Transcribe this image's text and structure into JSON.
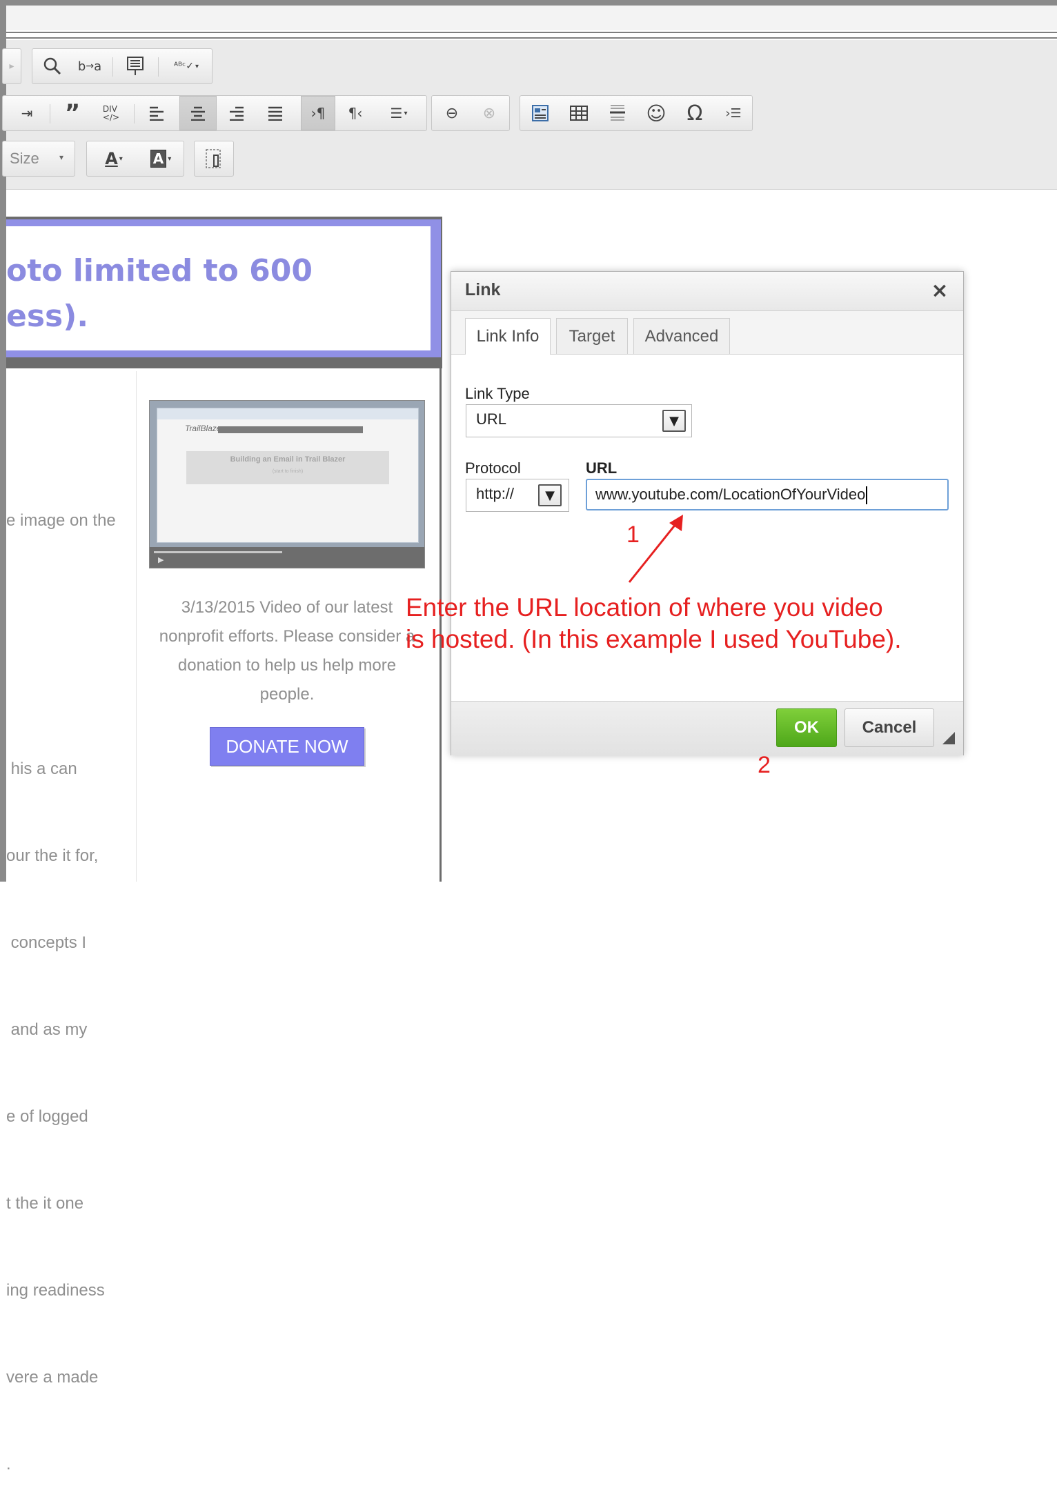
{
  "toolbar": {
    "row2_icons": [
      "indent-icon",
      "blockquote-icon",
      "create-div-icon",
      "align-left-icon",
      "align-center-icon",
      "align-right-icon",
      "justify-icon",
      "ltr-icon",
      "rtl-icon",
      "language-icon",
      "link-icon",
      "unlink-icon",
      "image-icon",
      "table-icon",
      "horizontal-rule-icon",
      "smiley-icon",
      "special-char-icon",
      "page-break-icon"
    ],
    "size_label": "Size",
    "text_color_glyph": "A",
    "bg_color_glyph": "A"
  },
  "content": {
    "banner_line1": "oto limited to 600",
    "banner_line2": "ess).",
    "left_lines": [
      "e image on the",
      "",
      " his a can",
      "our the it for,",
      " concepts I",
      " and as my",
      "e of logged",
      "t the it one",
      "ing readiness",
      "vere a made",
      "."
    ],
    "thumbnail": {
      "logo": "TrailBlazer",
      "title": "Building an Email in Trail Blazer",
      "subtitle": "(start to finish)"
    },
    "caption": "3/13/2015 Video of our latest nonprofit efforts. Please consider a donation to help us help more people.",
    "donate_label": "DONATE NOW"
  },
  "dialog": {
    "title": "Link",
    "close_glyph": "×",
    "tabs": [
      {
        "label": "Link Info",
        "active": true
      },
      {
        "label": "Target",
        "active": false
      },
      {
        "label": "Advanced",
        "active": false
      }
    ],
    "link_type_label": "Link Type",
    "link_type_value": "URL",
    "protocol_label": "Protocol",
    "protocol_value": "http://",
    "url_label": "URL",
    "url_value": "www.youtube.com/LocationOfYourVideo",
    "ok_label": "OK",
    "cancel_label": "Cancel"
  },
  "annotations": {
    "step1": "1",
    "step2": "2",
    "instruction_line1": "Enter the URL location of where you video",
    "instruction_line2": "is hosted. (In this example I used YouTube).",
    "color": "#e62020"
  }
}
